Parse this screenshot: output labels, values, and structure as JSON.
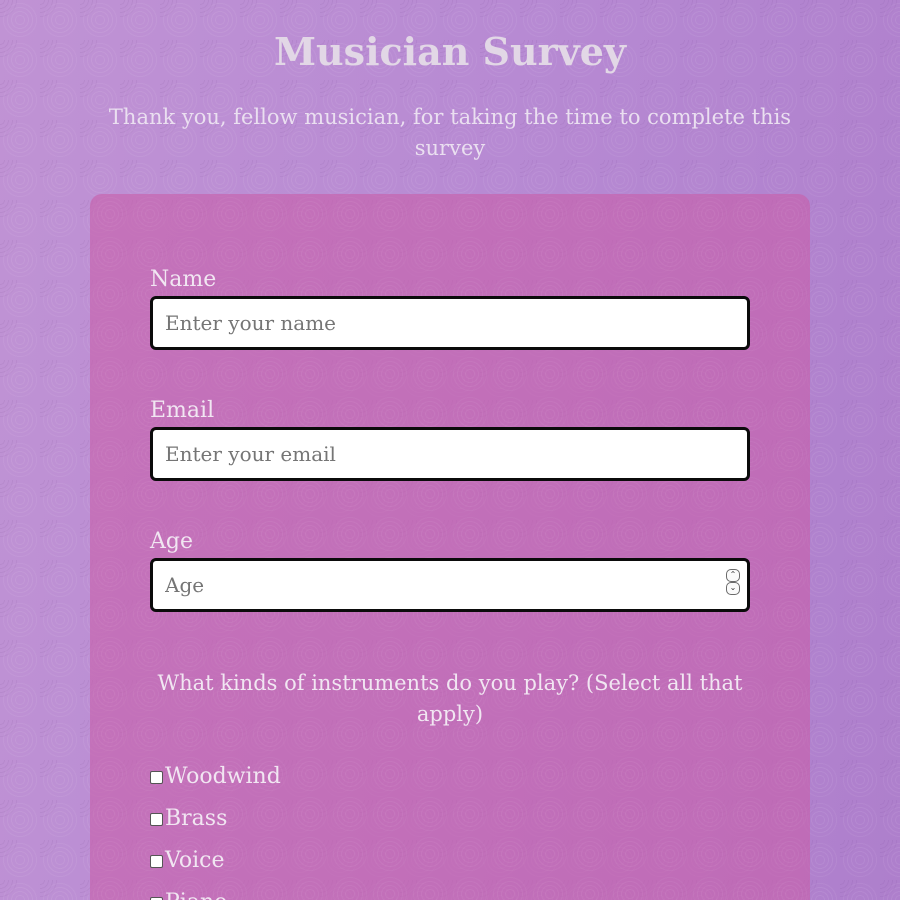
{
  "header": {
    "title": "Musician Survey",
    "description": "Thank you, fellow musician, for taking the time to complete this survey"
  },
  "form": {
    "name": {
      "label": "Name",
      "placeholder": "Enter your name",
      "value": ""
    },
    "email": {
      "label": "Email",
      "placeholder": "Enter your email",
      "value": ""
    },
    "age": {
      "label": "Age",
      "placeholder": "Age",
      "value": ""
    },
    "instruments": {
      "question": "What kinds of instruments do you play? (Select all that apply)",
      "options": [
        {
          "label": "Woodwind",
          "checked": false
        },
        {
          "label": "Brass",
          "checked": false
        },
        {
          "label": "Voice",
          "checked": false
        },
        {
          "label": "Piano",
          "checked": false
        }
      ]
    }
  },
  "icons": {
    "spinner_up": "chevron-up-icon",
    "spinner_down": "chevron-down-icon"
  },
  "colors": {
    "background": "#b98ad2",
    "card": "#c35fab",
    "text": "#e6dbea",
    "input_border": "#0b0b0b"
  }
}
